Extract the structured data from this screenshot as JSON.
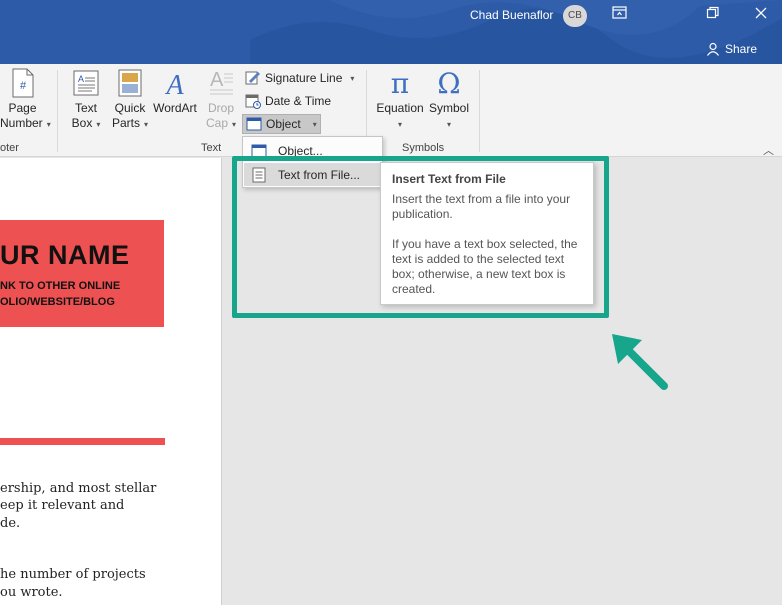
{
  "titlebar": {
    "user_name": "Chad Buenaflor",
    "avatar_initials": "CB",
    "share_label": "Share",
    "bg_color": "#2e5ba8"
  },
  "ribbon": {
    "header_footer": {
      "page_number_line1": "Page",
      "page_number_line2": "Number",
      "group_label_fragment": "oter"
    },
    "text_group": {
      "label": "Text",
      "text_box_line1": "Text",
      "text_box_line2": "Box",
      "quick_parts_line1": "Quick",
      "quick_parts_line2": "Parts",
      "wordart_label": "WordArt",
      "drop_cap_line1": "Drop",
      "drop_cap_line2": "Cap",
      "signature_line_label": "Signature Line",
      "date_time_label": "Date & Time",
      "object_label": "Object"
    },
    "symbols_group": {
      "label": "Symbols",
      "equation_label": "Equation",
      "symbol_label": "Symbol"
    }
  },
  "object_menu": {
    "items": [
      {
        "label": "Object...",
        "icon": "object-window-icon"
      },
      {
        "label": "Text from File...",
        "icon": "text-file-icon",
        "hovered": true
      }
    ]
  },
  "tooltip": {
    "title": "Insert Text from File",
    "paragraph1": [
      "Insert the text from a file into your",
      "publication."
    ],
    "paragraph2": [
      "If you have a text box selected, the",
      "text is added to the selected text",
      "box; otherwise, a new text box is",
      "created."
    ]
  },
  "document": {
    "name_title": "UR NAME",
    "name_sub_line1": "NK TO OTHER ONLINE",
    "name_sub_line2": "OLIO/WEBSITE/BLOG",
    "body_lines": [
      "ership, and most stellar",
      "eep it relevant and",
      "de.",
      "he number of projects",
      "ou wrote."
    ],
    "accent_color": "#ee5152"
  },
  "annotation": {
    "color": "#17a68c"
  }
}
